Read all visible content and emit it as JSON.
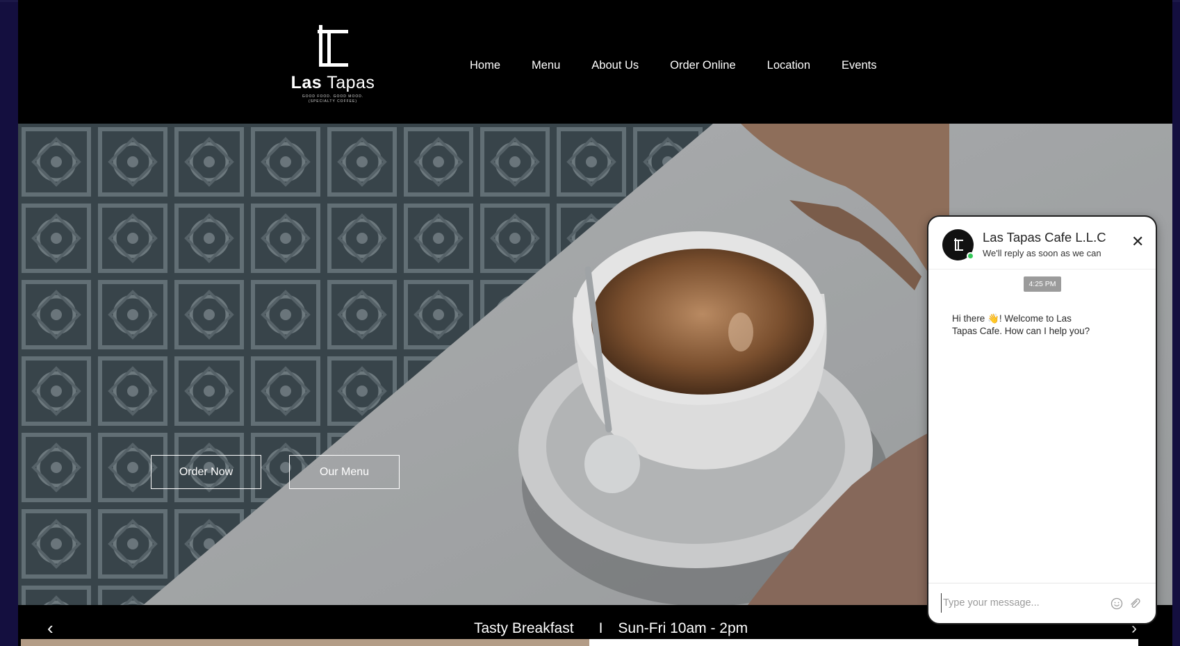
{
  "brand": {
    "name_bold": "Las",
    "name_light": "Tapas",
    "tagline": "GOOD FOOD. GOOD MOOD.",
    "tagline2": "(SPECIALTY COFFEE)"
  },
  "nav": {
    "items": [
      {
        "label": "Home"
      },
      {
        "label": "Menu"
      },
      {
        "label": "About Us"
      },
      {
        "label": "Order Online"
      },
      {
        "label": "Location"
      },
      {
        "label": "Events"
      }
    ]
  },
  "hero": {
    "order_button": "Order Now",
    "menu_button": "Our Menu"
  },
  "strip": {
    "title": "Tasty Breakfast",
    "separator": "I",
    "hours": "Sun-Fri 10am - 2pm",
    "prev_icon": "chevron-left-icon",
    "next_icon": "chevron-right-icon"
  },
  "chat": {
    "title": "Las Tapas Cafe L.L.C",
    "subtitle": "We'll reply as soon as we can",
    "time": "4:25 PM",
    "message": "Hi there 👋! Welcome to Las Tapas Cafe. How can I help you?",
    "input_placeholder": "Type your message...",
    "status_color": "#34c759"
  },
  "colors": {
    "page_bg": "#140f3f",
    "header_bg": "#000000",
    "text": "#ffffff"
  }
}
